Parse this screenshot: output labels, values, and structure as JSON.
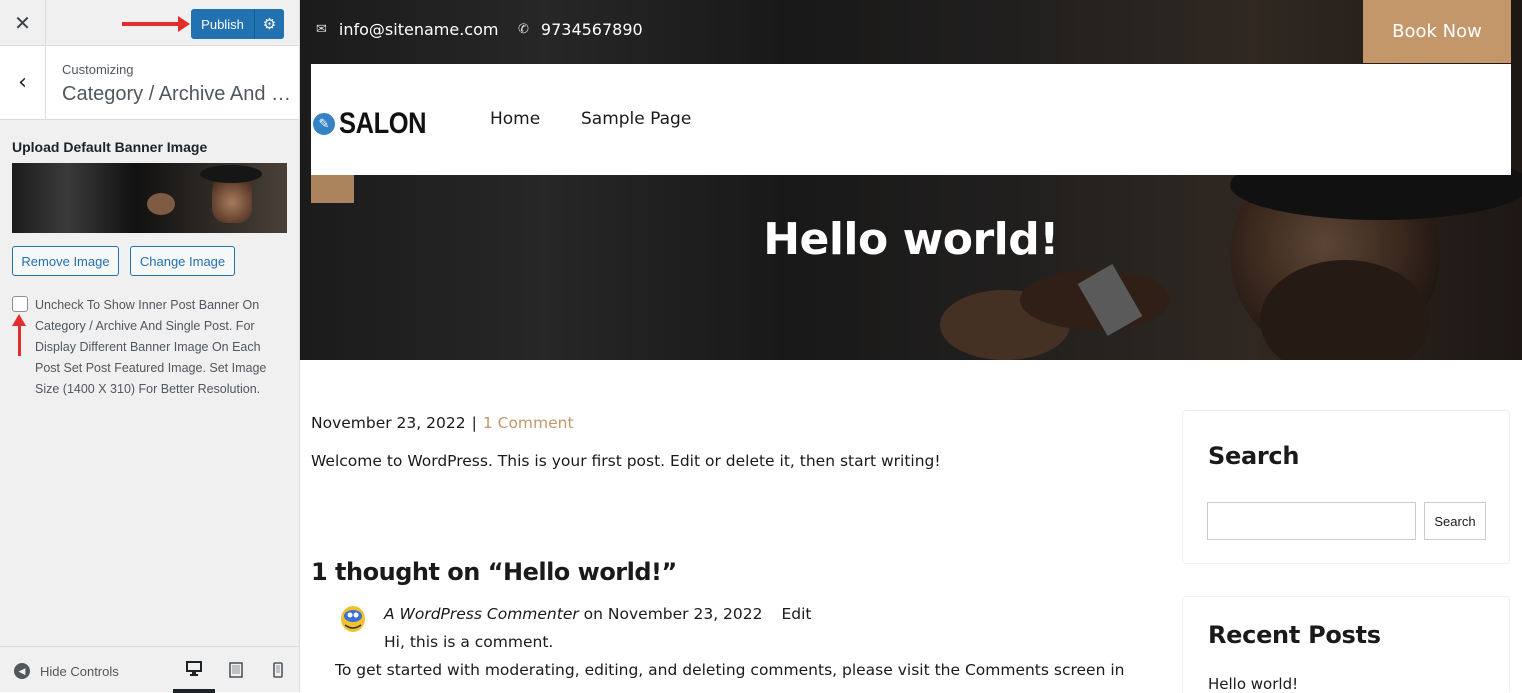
{
  "sidebar": {
    "publish_label": "Publish",
    "customizing_label": "Customizing",
    "section_name": "Category / Archive And Single Post",
    "control_title": "Upload Default Banner Image",
    "remove_image_label": "Remove Image",
    "change_image_label": "Change Image",
    "checkbox_checked": false,
    "checkbox_description": "Uncheck To Show Inner Post Banner On Category / Archive And Single Post. For Display Different Banner Image On Each Post Set Post Featured Image. Set Image Size (1400 X 310) For Better Resolution.",
    "hide_controls_label": "Hide Controls",
    "devices": [
      "desktop",
      "tablet",
      "mobile"
    ],
    "active_device": "desktop",
    "accent_color": "#2271b1",
    "annotation_arrow_color": "#e42c2c"
  },
  "preview": {
    "topbar": {
      "email": "info@sitename.com",
      "phone": "9734567890",
      "book_now": "Book Now"
    },
    "logo_text": "SALON",
    "nav": [
      "Home",
      "Sample Page"
    ],
    "hero_title": "Hello world!",
    "post": {
      "date": "November 23, 2022",
      "separator": "|",
      "comments_link": "1 Comment",
      "excerpt": "Welcome to WordPress. This is your first post. Edit or delete it, then start writing!"
    },
    "comments": {
      "heading": "1 thought on “Hello world!”",
      "author": "A WordPress Commenter",
      "on_word": "on",
      "date": "November 23, 2022",
      "edit_label": "Edit",
      "text": "Hi, this is a comment.",
      "more_text": "To get started with moderating, editing, and deleting comments, please visit the Comments screen in"
    },
    "widgets": {
      "search_title": "Search",
      "search_button": "Search",
      "recent_title": "Recent Posts",
      "recent_items": [
        "Hello world!"
      ]
    },
    "accent_color": "#c4976a"
  }
}
